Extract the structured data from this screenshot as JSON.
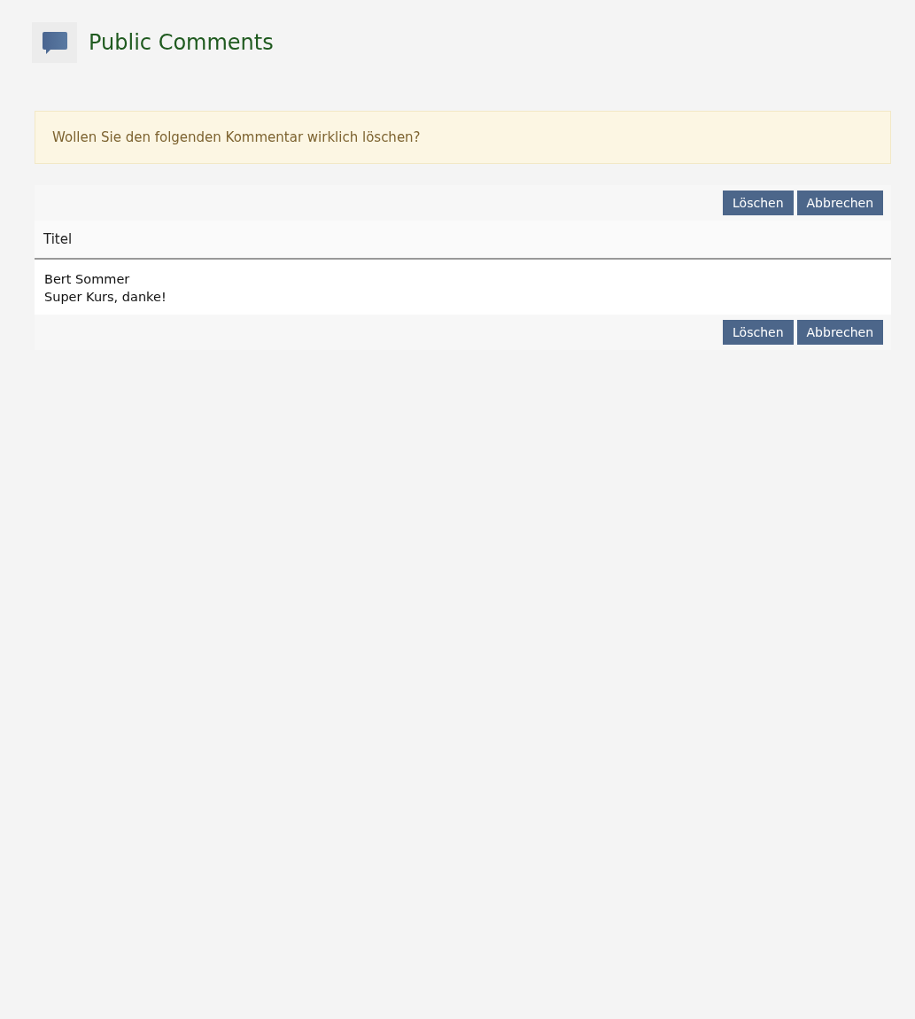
{
  "header": {
    "title": "Public Comments"
  },
  "alert": {
    "message": "Wollen Sie den folgenden Kommentar wirklich löschen?"
  },
  "toolbar_top": {
    "buttons": [
      "Löschen",
      "Abbrechen"
    ]
  },
  "table": {
    "columns": [
      "Titel"
    ],
    "rows": [
      {
        "author": "Bert Sommer",
        "text": "Super Kurs, danke!"
      }
    ]
  },
  "toolbar_bottom": {
    "buttons": [
      "Löschen",
      "Abbrechen"
    ]
  }
}
